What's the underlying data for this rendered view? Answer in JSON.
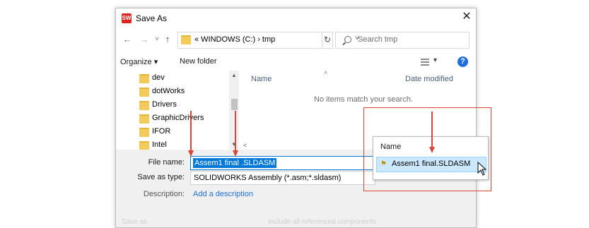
{
  "dialog": {
    "title": "Save As",
    "close_glyph": "✕",
    "app_icon": "solidworks-icon"
  },
  "nav": {
    "back_glyph": "←",
    "forward_glyph": "→",
    "recent_glyph": "˅",
    "up_glyph": "↑",
    "address_path": "« WINDOWS (C:) › tmp",
    "address_dropdown_glyph": "˅",
    "refresh_glyph": "↻",
    "search_placeholder": "Search tmp"
  },
  "toolbar": {
    "organize_label": "Organize ▾",
    "new_folder_label": "New folder",
    "views_caret": "▾",
    "help_glyph": "?"
  },
  "tree": {
    "items": [
      {
        "label": "dev"
      },
      {
        "label": "dotWorks"
      },
      {
        "label": "Drivers"
      },
      {
        "label": "GraphicDrivers"
      },
      {
        "label": "IFOR"
      },
      {
        "label": "Intel"
      }
    ],
    "scroll_up": "▲",
    "scroll_down": "▼"
  },
  "filelist": {
    "columns": [
      "Name",
      "Date modified"
    ],
    "sort_caret": "˄",
    "empty_message": "No items match your search.",
    "hscroll_left": "<"
  },
  "form": {
    "file_name_label": "File name:",
    "file_name_value": "Assem1 final .SLDASM",
    "save_as_type_label": "Save as type:",
    "save_as_type_value": "SOLIDWORKS Assembly (*.asm;*.sldasm)",
    "description_label": "Description:",
    "description_link": "Add a description",
    "faint_left": "Save as",
    "faint_right": "Include all referenced components"
  },
  "popup": {
    "header": "Name",
    "item_label": "Assem1 final.SLDASM",
    "item_icon": "assembly-file-icon"
  },
  "colors": {
    "accent": "#0078d7",
    "annotation_red": "#d94637",
    "selection_bg": "#cce8ff",
    "link": "#1e6fd9"
  }
}
